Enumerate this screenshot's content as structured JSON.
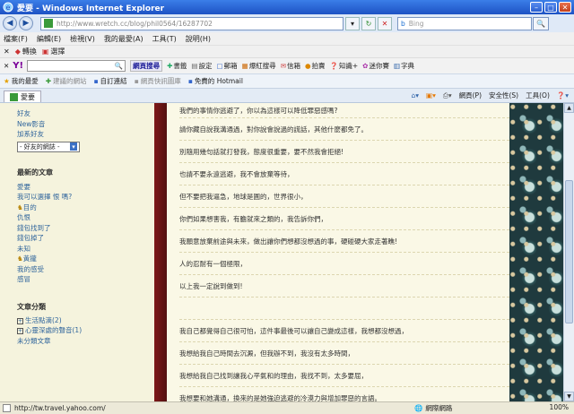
{
  "window": {
    "title": "愛要 - Windows Internet Explorer"
  },
  "address": {
    "url": "http://www.wretch.cc/blog/phil0564/16287702",
    "search_placeholder": "Bing"
  },
  "menu": [
    "檔案(F)",
    "編輯(E)",
    "檢視(V)",
    "我的最愛(A)",
    "工具(T)",
    "說明(H)"
  ],
  "toolbar1": {
    "convert": "轉換",
    "select": "選擇"
  },
  "yahoo": {
    "web_search": "網頁搜尋",
    "bookmarks": "書籤",
    "settings": "設定",
    "mail": "郵箱",
    "news": "爆紅搜尋",
    "mailbox": "信箱",
    "auction": "拍賣",
    "knowledge": "知識+",
    "dictionary": "字典",
    "games": "迷你賽"
  },
  "favorites": {
    "label": "我的最愛",
    "items": [
      "建議的網站",
      "自訂連結",
      "網頁快訊圖庫",
      "免費的 Hotmail"
    ]
  },
  "tab": {
    "title": "愛要"
  },
  "command_bar": {
    "page": "網頁(P)",
    "safety": "安全性(S)",
    "tools": "工具(O)"
  },
  "sidebar": {
    "top_links": [
      "好友",
      "New影音",
      "加系好友"
    ],
    "friends_select": "- 好友的網誌 -",
    "recent_heading": "最新的文章",
    "recent_posts": [
      "愛要",
      "我可以選擇 恨 嗎?",
      "目的",
      "仇恨",
      "錢包找到了",
      "錢包掉了",
      "未知",
      "黃攏",
      "我的感受",
      "感冒"
    ],
    "categories_heading": "文章分類",
    "categories": [
      "生活點滴(2)",
      "心靈深處的聲音(1)",
      "未分類文章"
    ]
  },
  "article": {
    "lines": [
      "我們的事情你逃避了，你以為這樣可以降低罪惡感嗎?",
      "請你藏自說我溝通過，對你說會說過的謊話，其他什麼都免了。",
      "別隨用幾句話就打發我，態度很重要，要不然我會拒絕!",
      "也請不要永遠逃避，我不會放棄等待，",
      "但不要把我逼急，地球是圓的，世界很小，",
      "你們如果想害我，有膽就來之類的，我告訴你們，",
      "我願意放棄前途與未來，做出讓你們想都沒想過的事，硬碰硬大家走著瞧!",
      "人的忍耐有一個極限，",
      "以上我一定說到做到!",
      "",
      "我自己都覺得自己很可怕，這件事最後可以讓自己變成這樣，我想都沒想過，",
      "我想給我自己時間去沉澱，但我辦不到，我沒有太多時間，",
      "我想給我自己找到讓我心平氣和的理由，我找不到，太多要屈，",
      "我想要和她溝通，換來的是她強迫逃避的冷漠力與增加罪惡的言語。"
    ]
  },
  "status": {
    "url": "http://tw.travel.yahoo.com/",
    "zone": "網際網路",
    "zoom": "100%"
  },
  "colors": {
    "spine": "#7d1818",
    "page": "#faf8e6",
    "sidebar": "#f5f3dd",
    "link": "#30659c"
  }
}
